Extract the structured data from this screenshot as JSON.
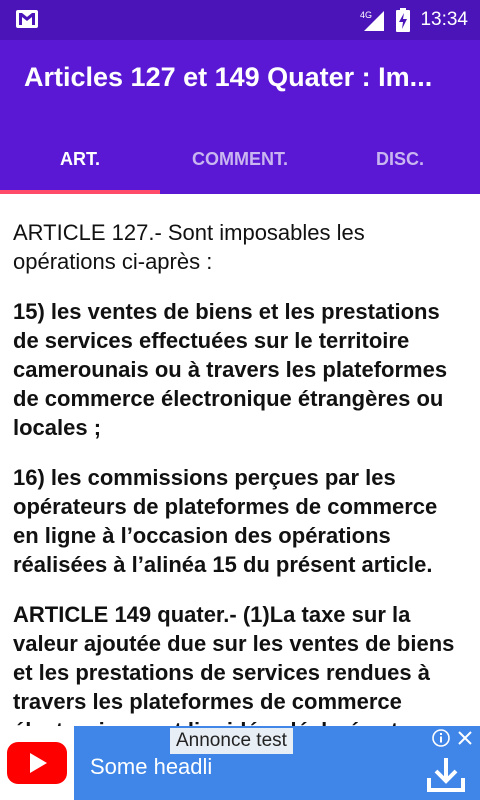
{
  "status_bar": {
    "time": "13:34",
    "network": "4G",
    "icons": [
      "gmail-icon",
      "signal-icon",
      "battery-charging-icon"
    ]
  },
  "app_bar": {
    "title": "Articles 127 et 149 Quater : Im..."
  },
  "tabs": [
    {
      "label": "ART.",
      "active": true
    },
    {
      "label": "COMMENT.",
      "active": false
    },
    {
      "label": "DISC.",
      "active": false
    }
  ],
  "content": {
    "paragraphs": [
      {
        "text": "ARTICLE 127.- Sont imposables les opérations ci-après :",
        "bold": false
      },
      {
        "text": "15) les ventes de biens et les prestations de services effectuées sur le territoire camerounais ou à travers les plateformes de commerce électronique étrangères ou locales ;",
        "bold": true
      },
      {
        "text": "16) les commissions perçues par les opérateurs de plateformes de commerce en ligne à l’occasion des opérations réalisées à l’alinéa 15 du présent article.",
        "bold": true
      },
      {
        "text": "ARTICLE 149 quater.- (1)La taxe sur la valeur ajoutée due sur les ventes de biens et les prestations de services rendues à travers les plateformes de commerce électronique est liquidée, déclarée et",
        "bold": true
      }
    ]
  },
  "ad": {
    "label": "Annonce test",
    "headline": "Some headli",
    "colors": {
      "background": "#3f86e8",
      "youtube_red": "#ff0000"
    }
  },
  "colors": {
    "status_bar": "#4a14b8",
    "app_bar": "#5a18d4",
    "indicator": "#ff4a6a"
  }
}
